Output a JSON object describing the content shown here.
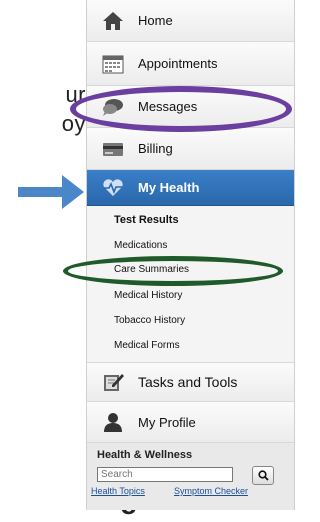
{
  "background_text": {
    "line1": "ur",
    "line2": "oy",
    "line3": "e"
  },
  "nav": {
    "home": "Home",
    "appointments": "Appointments",
    "messages": "Messages",
    "billing": "Billing",
    "my_health": "My Health",
    "tasks_and_tools": "Tasks and Tools",
    "my_profile": "My Profile"
  },
  "my_health_submenu": [
    "Test Results",
    "Medications",
    "Care Summaries",
    "Medical History",
    "Tobacco History",
    "Medical Forms"
  ],
  "health_wellness": {
    "title": "Health & Wellness",
    "search_placeholder": "Search",
    "link_health_topics": "Health Topics",
    "link_symptom_checker": "Symptom Checker"
  },
  "colors": {
    "active_blue": "#2f6fb8",
    "arrow_blue": "#4a86c8",
    "highlight_purple": "#6b3fa0",
    "highlight_green": "#1f5a2a"
  },
  "icons": [
    "home-icon",
    "calendar-icon",
    "speech-bubble-icon",
    "credit-card-icon",
    "heart-pulse-icon",
    "clipboard-pencil-icon",
    "person-icon",
    "search-icon"
  ]
}
